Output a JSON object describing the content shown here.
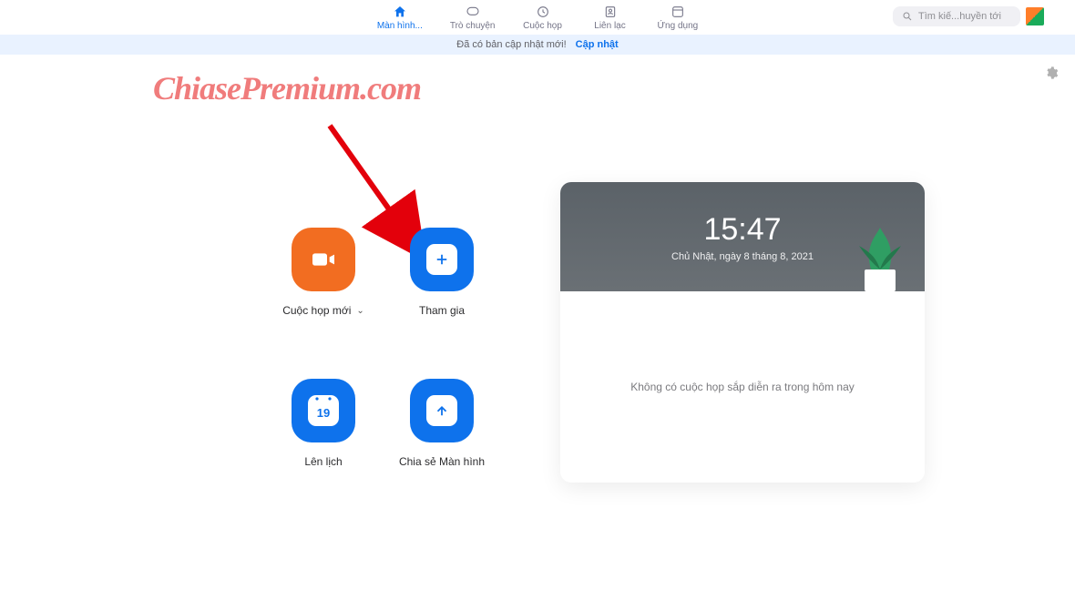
{
  "topbar": {
    "tabs": [
      {
        "label": "Màn hình..."
      },
      {
        "label": "Trò chuyện"
      },
      {
        "label": "Cuộc họp"
      },
      {
        "label": "Liên lạc"
      },
      {
        "label": "Ứng dụng"
      }
    ],
    "search_placeholder": "Tìm kiế...huyền tới"
  },
  "banner": {
    "text": "Đã có bản cập nhật mới!",
    "link": "Cập nhật"
  },
  "watermark": "ChiasePremium.com",
  "tiles": {
    "new_meeting": "Cuộc họp mới",
    "join": "Tham gia",
    "schedule": "Lên lịch",
    "schedule_day": "19",
    "share_screen": "Chia sẻ Màn hình"
  },
  "panel": {
    "time": "15:47",
    "date": "Chủ Nhật, ngày 8 tháng 8, 2021",
    "no_meetings": "Không có cuộc họp sắp diễn ra trong hôm nay"
  }
}
